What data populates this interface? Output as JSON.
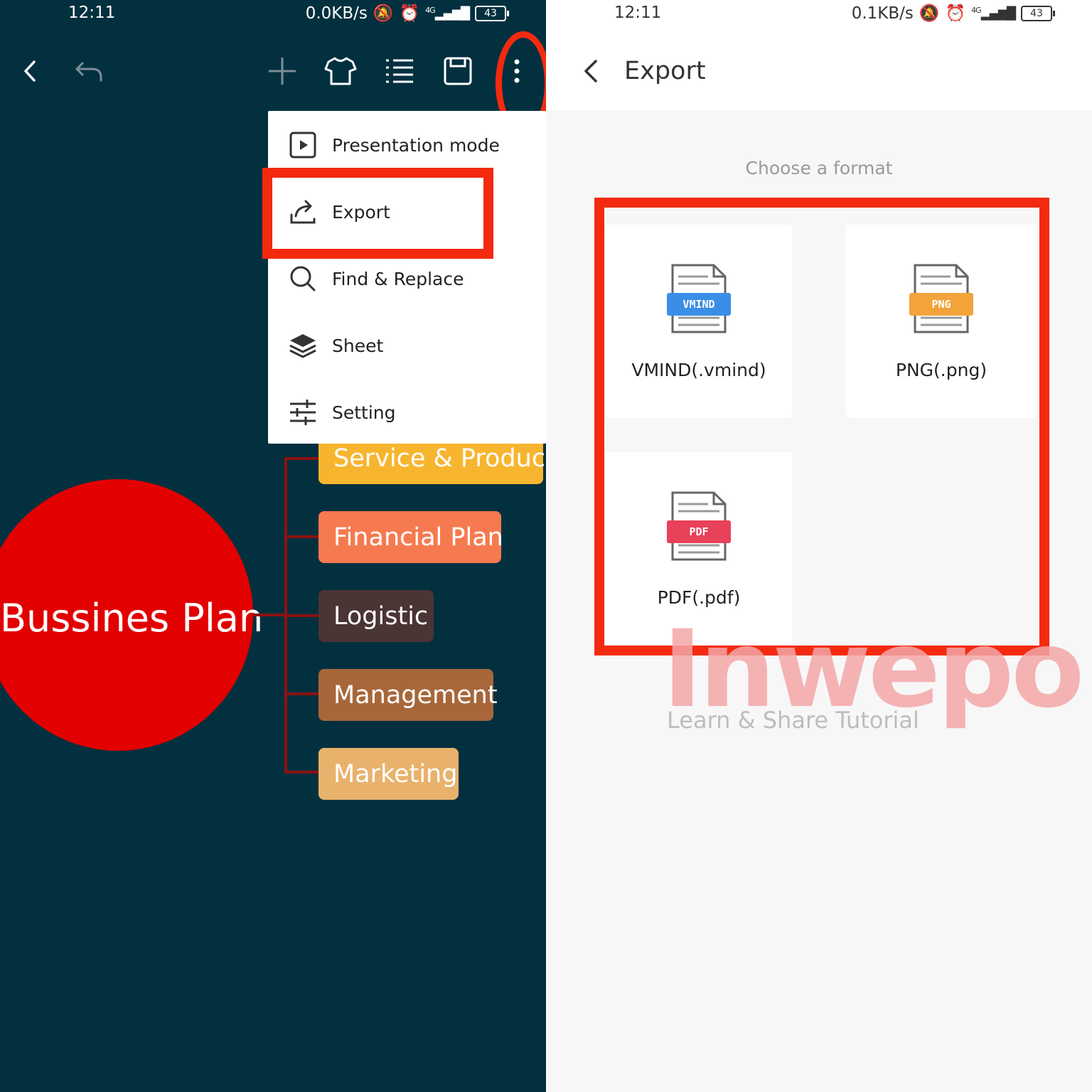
{
  "left": {
    "status": {
      "time": "12:11",
      "speed": "0.0KB/s",
      "network": "4G",
      "battery": "43"
    },
    "menu": {
      "items": [
        {
          "label": "Presentation mode",
          "icon": "play-icon"
        },
        {
          "label": "Export",
          "icon": "share-icon"
        },
        {
          "label": "Find & Replace",
          "icon": "search-icon"
        },
        {
          "label": "Sheet",
          "icon": "layers-icon"
        },
        {
          "label": "Setting",
          "icon": "sliders-icon"
        }
      ]
    },
    "mindmap": {
      "central": "Bussines Plan",
      "nodes": [
        {
          "label": "Service & Product",
          "color": "#f7b52f"
        },
        {
          "label": "Financial Plan",
          "color": "#f67a4f"
        },
        {
          "label": "Logistic",
          "color": "#4b3434"
        },
        {
          "label": "Management",
          "color": "#a7673a"
        },
        {
          "label": "Marketing",
          "color": "#e8b26c"
        }
      ]
    }
  },
  "right": {
    "status": {
      "time": "12:11",
      "speed": "0.1KB/s",
      "network": "4G",
      "battery": "43"
    },
    "title": "Export",
    "subtitle": "Choose a format",
    "formats": [
      {
        "badge": "VMIND",
        "label": "VMIND(.vmind)",
        "color": "#3a8ee6"
      },
      {
        "badge": "PNG",
        "label": "PNG(.png)",
        "color": "#f2a33a"
      },
      {
        "badge": "PDF",
        "label": "PDF(.pdf)",
        "color": "#e8415a"
      }
    ]
  },
  "watermark": {
    "brand": "Inwepo",
    "tagline": "Learn & Share Tutorial"
  },
  "colors": {
    "annotation": "#f32a0f",
    "canvas": "#03303f",
    "central": "#e20000"
  }
}
